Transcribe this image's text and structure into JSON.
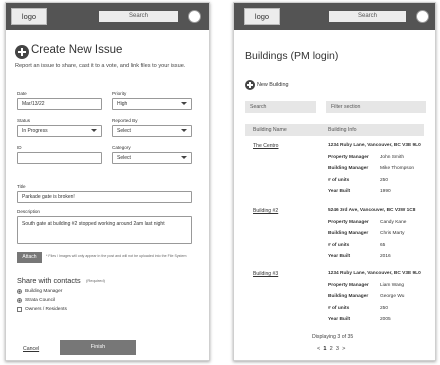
{
  "left": {
    "logo": "logo",
    "search": "Search",
    "page_title": "Create New Issue",
    "intro": "Report an issue to share, cast it to a vote, and link files to your issue.",
    "date": {
      "label": "Date",
      "value": "Mar/13/22"
    },
    "priority": {
      "label": "Priority",
      "value": "High"
    },
    "status": {
      "label": "Status",
      "value": "In Progress"
    },
    "reported_by": {
      "label": "Reported By",
      "value": "Select"
    },
    "id": {
      "label": "ID",
      "value": ""
    },
    "category": {
      "label": "Category",
      "value": "Select"
    },
    "title": {
      "label": "Title",
      "value": "Parkade gate is broken!"
    },
    "description": {
      "label": "Description",
      "value": "South gate at building #2 stopped working around 2am last night"
    },
    "attach_label": "Attach",
    "attach_note": "* Files / Images will only appear in the post and will not be uploaded into the File System",
    "share_heading": "Share with contacts",
    "share_required": "(Required)",
    "share_options": [
      {
        "label": "Building Manager",
        "checked": true
      },
      {
        "label": "Strata Council",
        "checked": true
      },
      {
        "label": "Owners / Residents",
        "checked": false
      }
    ],
    "cancel_label": "Cancel",
    "finish_label": "Finish"
  },
  "right": {
    "logo": "logo",
    "search": "Search",
    "page_title": "Buildings (PM login)",
    "new_building_label": "New Building",
    "search_box": "Search",
    "filter_box": "Filter section",
    "columns": [
      "Building Name",
      "Building Info"
    ],
    "buildings": [
      {
        "name": "The Centro",
        "address": "1234 Ruby Lane, Vancouver, BC V3E 9L0",
        "rows": [
          [
            "Property Manager",
            "John Smith"
          ],
          [
            "Building Manager",
            "Mike Thompson"
          ],
          [
            "# of units",
            "250"
          ],
          [
            "Year Built",
            "1990"
          ]
        ]
      },
      {
        "name": "Building #2",
        "address": "5246 3rd Ave, Vancouver, BC V3W 1C8",
        "rows": [
          [
            "Property Manager",
            "Candy Kane"
          ],
          [
            "Building Manager",
            "Chris Marty"
          ],
          [
            "# of units",
            "65"
          ],
          [
            "Year Built",
            "2016"
          ]
        ]
      },
      {
        "name": "Building #3",
        "address": "1234 Ruby Lane, Vancouver, BC V3E 9L0",
        "rows": [
          [
            "Property Manager",
            "Liam Wang"
          ],
          [
            "Building Manager",
            "George Wu"
          ],
          [
            "# of units",
            "250"
          ],
          [
            "Year Built",
            "2005"
          ]
        ]
      }
    ],
    "displaying": "Displaying 3 of 35",
    "pagination": {
      "prev": "<",
      "pages": [
        "1",
        "2",
        "3"
      ],
      "next": ">",
      "current": "1"
    }
  }
}
